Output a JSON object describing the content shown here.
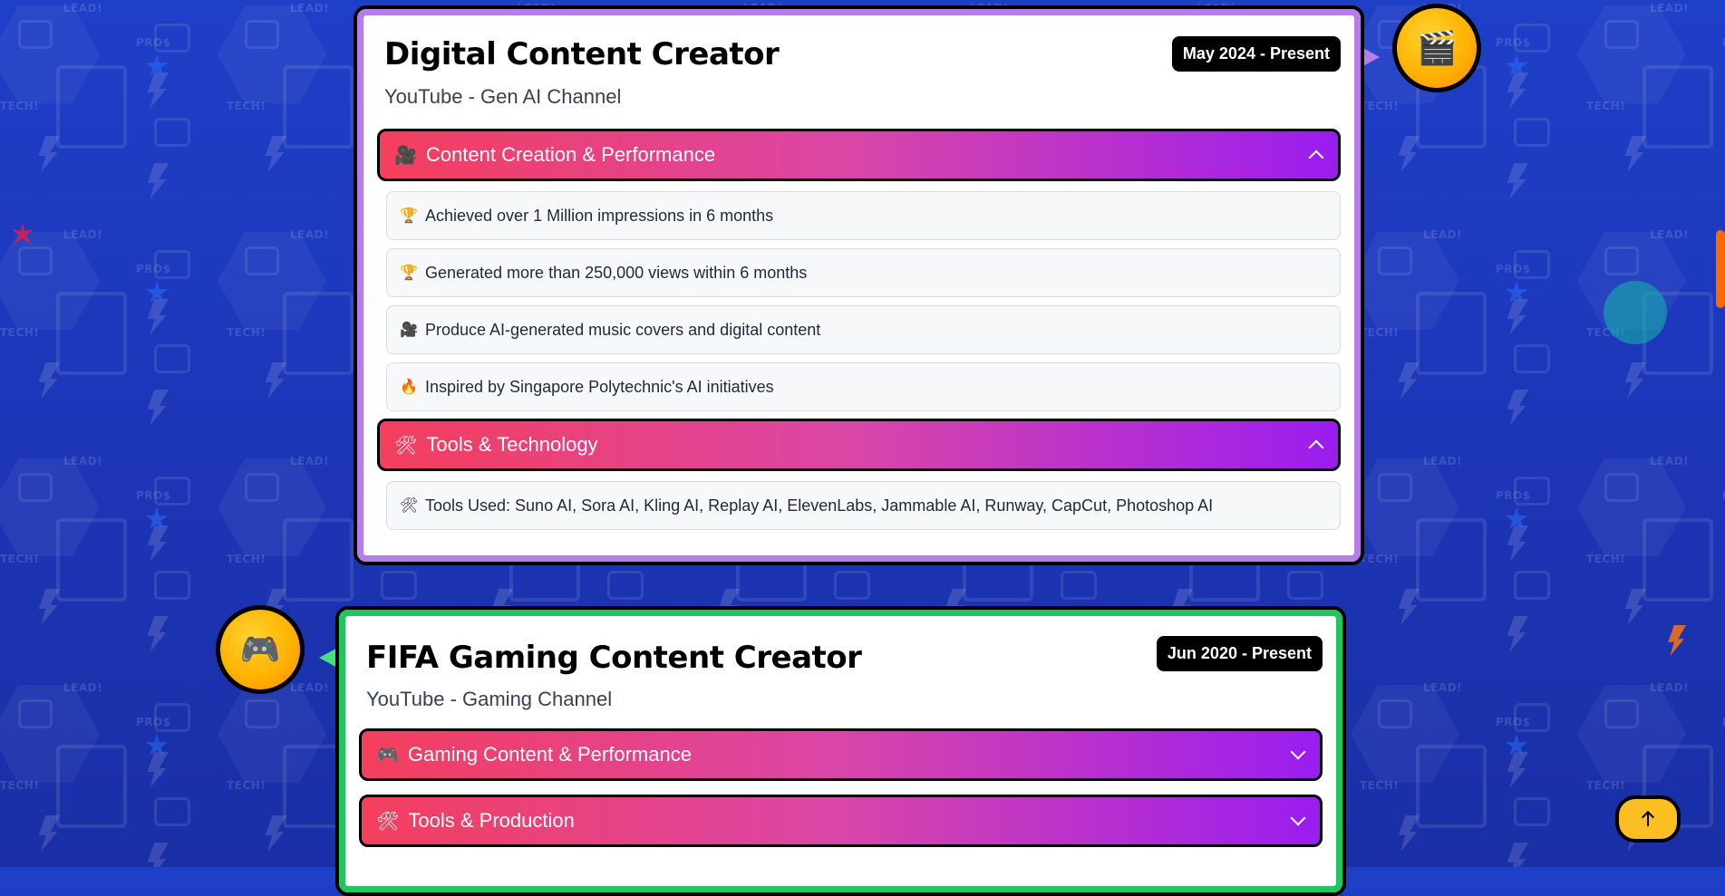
{
  "colors": {
    "background": "#1e3fc8",
    "card1_border": "#b57ee8",
    "card2_border": "#22c55e",
    "section_gradient_start": "#f43f5e",
    "section_gradient_end": "#9a1df0",
    "badge_bg": "#000000",
    "icon_circle": "#ffb300",
    "scroll_top_button": "#fbbf24",
    "scrollbar": "#ff6a00"
  },
  "pattern_words": [
    "LEAD!",
    "PRO$",
    "TECH!"
  ],
  "cards": [
    {
      "title": "Digital Content Creator",
      "subtitle": "YouTube - Gen AI Channel",
      "date": "May 2024 - Present",
      "icon": "🎬",
      "icon_name": "clapperboard-icon",
      "sections": [
        {
          "icon": "🎥",
          "icon_name": "movie-camera-icon",
          "label": "Content Creation & Performance",
          "expanded": true,
          "items": [
            {
              "icon": "🏆",
              "icon_name": "trophy-icon",
              "text": "Achieved over 1 Million impressions in 6 months"
            },
            {
              "icon": "🏆",
              "icon_name": "trophy-icon",
              "text": "Generated more than 250,000 views within 6 months"
            },
            {
              "icon": "🎥",
              "icon_name": "movie-camera-icon",
              "text": "Produce AI-generated music covers and digital content"
            },
            {
              "icon": "🔥",
              "icon_name": "fire-icon",
              "text": "Inspired by Singapore Polytechnic's AI initiatives"
            }
          ]
        },
        {
          "icon": "🛠",
          "icon_name": "tools-icon",
          "label": "Tools & Technology",
          "expanded": true,
          "items": [
            {
              "icon": "🛠",
              "icon_name": "tools-icon",
              "text": "Tools Used: Suno AI, Sora AI, Kling AI, Replay AI, ElevenLabs, Jammable AI, Runway, CapCut, Photoshop AI"
            }
          ]
        }
      ]
    },
    {
      "title": "FIFA Gaming Content Creator",
      "subtitle": "YouTube - Gaming Channel",
      "date": "Jun 2020 - Present",
      "icon": "🎮",
      "icon_name": "game-controller-icon",
      "sections": [
        {
          "icon": "🎮",
          "icon_name": "game-controller-icon",
          "label": "Gaming Content & Performance",
          "expanded": false
        },
        {
          "icon": "🛠",
          "icon_name": "tools-icon",
          "label": "Tools & Production",
          "expanded": false
        }
      ]
    }
  ]
}
